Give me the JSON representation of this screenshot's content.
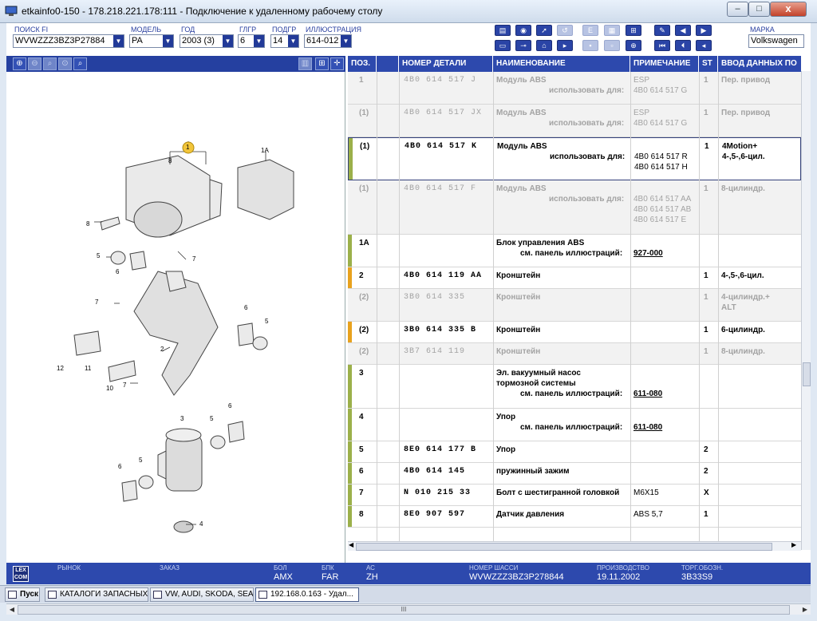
{
  "window": {
    "title": "etkainfo0-150 - 178.218.221.178:111 - Подключение к удаленному рабочему столу",
    "min": "–",
    "max": "□",
    "close": "x"
  },
  "filters": [
    {
      "label": "ПОИСК FI",
      "value": "WVWZZZ3BZ3P27884"
    },
    {
      "label": "МОДЕЛЬ",
      "value": "PA"
    },
    {
      "label": "ГОД",
      "value": "2003 (3)"
    },
    {
      "label": "ГЛГР",
      "value": "6"
    },
    {
      "label": "ПОДГР",
      "value": "14"
    },
    {
      "label": "ИЛЛЮСТРАЦИЯ",
      "value": "614-012"
    }
  ],
  "brand": {
    "label": "МАРКА",
    "value": "Volkswagen"
  },
  "table": {
    "columns": [
      "ПОЗ.",
      "НОМЕР ДЕТАЛИ",
      "НАИМЕНОВАНИЕ",
      "ПРИМЕЧАНИЕ",
      "ST",
      "ВВОД ДАННЫХ ПО"
    ],
    "use_for": "использовать для:",
    "see_panel": "см. панель иллюстраций:",
    "rows": [
      {
        "pos": "1",
        "part": "4B0 614 517 J",
        "name": "Модуль ABS",
        "sub": "use",
        "note": [
          "ESP",
          "4B0 614 517 G"
        ],
        "st": "1",
        "input": [
          "Пер. привод"
        ],
        "state": "gray"
      },
      {
        "pos": "(1)",
        "part": "4B0 614 517 JX",
        "name": "Модуль ABS",
        "sub": "use",
        "note": [
          "ESP",
          "4B0 614 517 G"
        ],
        "st": "1",
        "input": [
          "Пер. привод"
        ],
        "state": "gray"
      },
      {
        "pos": "(1)",
        "part": "4B0 614 517 K",
        "name": "Модуль ABS",
        "sub": "use",
        "note": [
          "4B0 614 517 R",
          "4B0 614 517 H"
        ],
        "st": "1",
        "input": [
          "4Motion+",
          "4-,5-,6-цил."
        ],
        "state": "selected"
      },
      {
        "pos": "(1)",
        "part": "4B0 614 517 F",
        "name": "Модуль ABS",
        "sub": "use",
        "note": [
          "4B0 614 517 AA",
          "4B0 614 517 AB",
          "4B0 614 517 E"
        ],
        "st": "1",
        "input": [
          "8-цилиндр."
        ],
        "state": "gray"
      },
      {
        "pos": "1A",
        "part": "",
        "name": "Блок управления ABS",
        "sub": "panel",
        "link": "927-000",
        "note": [],
        "st": "",
        "input": [],
        "state": "normal"
      },
      {
        "pos": "2",
        "part": "4B0 614 119 AA",
        "name": "Кронштейн",
        "sub": "",
        "note": [],
        "st": "1",
        "input": [
          "4-,5-,6-цил."
        ],
        "state": "normal"
      },
      {
        "pos": "(2)",
        "part": "3B0 614 335",
        "name": "Кронштейн",
        "sub": "",
        "note": [],
        "st": "1",
        "input": [
          "4-цилиндр.+",
          "ALT"
        ],
        "state": "gray"
      },
      {
        "pos": "(2)",
        "part": "3B0 614 335 B",
        "name": "Кронштейн",
        "sub": "",
        "note": [],
        "st": "1",
        "input": [
          "6-цилиндр."
        ],
        "state": "normal"
      },
      {
        "pos": "(2)",
        "part": "3B7 614 119",
        "name": "Кронштейн",
        "sub": "",
        "note": [],
        "st": "1",
        "input": [
          "8-цилиндр."
        ],
        "state": "gray"
      },
      {
        "pos": "3",
        "part": "",
        "name": "Эл. вакуумный насос|тормозной системы",
        "sub": "panel",
        "link": "611-080",
        "note": [],
        "st": "",
        "input": [],
        "state": "normal"
      },
      {
        "pos": "4",
        "part": "",
        "name": "Упор",
        "sub": "panel",
        "link": "611-080",
        "note": [],
        "st": "",
        "input": [],
        "state": "normal"
      },
      {
        "pos": "5",
        "part": "8E0 614 177 B",
        "name": "Упор",
        "sub": "",
        "note": [],
        "st": "2",
        "input": [],
        "state": "normal"
      },
      {
        "pos": "6",
        "part": "4B0 614 145",
        "name": "пружинный зажим",
        "sub": "",
        "note": [],
        "st": "2",
        "input": [],
        "state": "normal"
      },
      {
        "pos": "7",
        "part": "N 010 215 33",
        "name": "Болт с шестигранной головкой",
        "sub": "",
        "note": [
          "M6X15"
        ],
        "st": "X",
        "input": [],
        "state": "normal"
      },
      {
        "pos": "8",
        "part": "8E0 907 597",
        "name": "Датчик давления",
        "sub": "",
        "note": [
          "ABS 5,7"
        ],
        "st": "1",
        "input": [],
        "state": "normal"
      }
    ]
  },
  "illustration": {
    "labels": [
      "1",
      "1A",
      "8",
      "8",
      "5",
      "6",
      "7",
      "7",
      "6",
      "5",
      "2",
      "12",
      "11",
      "10",
      "7",
      "3",
      "5",
      "6",
      "6",
      "5",
      "4"
    ]
  },
  "status": [
    {
      "label": "РЫНОК",
      "value": ""
    },
    {
      "label": "ЗАКАЗ",
      "value": ""
    },
    {
      "label": "БОЛ",
      "value": "AMX"
    },
    {
      "label": "БПК",
      "value": "FAR"
    },
    {
      "label": "АС",
      "value": "ZH"
    },
    {
      "label": "НОМЕР ШАССИ",
      "value": "WVWZZZ3BZ3P278844"
    },
    {
      "label": "ПРОИЗВОДСТВО",
      "value": "19.11.2002"
    },
    {
      "label": "ТОРГ.ОБОЗН.",
      "value": "3B33S9"
    }
  ],
  "logo": "LEX COM",
  "taskbar": {
    "start": "Пуск",
    "items": [
      "КАТАЛОГИ ЗАПАСНЫХ ...",
      "VW, AUDI, SKODA, SEAT",
      "192.168.0.163 - Удал..."
    ]
  },
  "scroll_grip": "III",
  "colors": {
    "blue": "#2d49ad",
    "marker_green": "#9bb04a",
    "marker_orange": "#e8a21e",
    "callout_yellow": "#f2c53a"
  }
}
